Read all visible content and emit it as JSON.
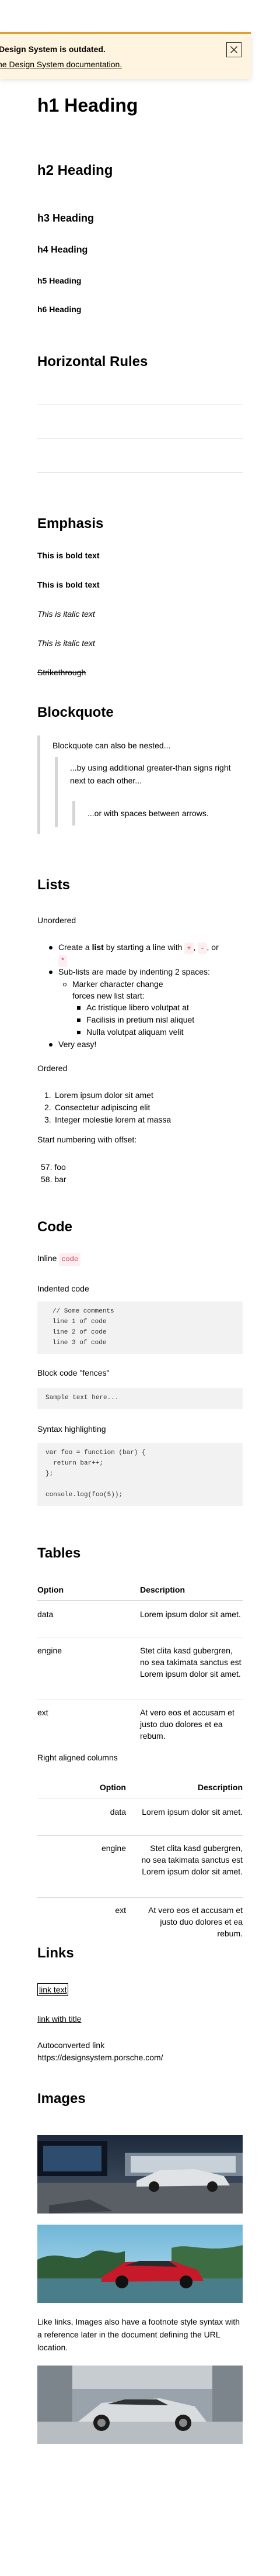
{
  "banner": {
    "title": "Design System is outdated.",
    "link": "he Design System documentation.",
    "close_icon": "close-icon",
    "colors": {
      "background": "#fff4df",
      "accent": "#e0a030"
    }
  },
  "headings": {
    "h1": "h1 Heading",
    "h2": "h2 Heading",
    "h3": "h3 Heading",
    "h4": "h4 Heading",
    "h5": "h5 Heading",
    "h6": "h6 Heading"
  },
  "sections": {
    "horizontal_rules": "Horizontal Rules",
    "emphasis": "Emphasis",
    "blockquote": "Blockquote",
    "lists": "Lists",
    "code": "Code",
    "tables": "Tables",
    "links": "Links",
    "images": "Images"
  },
  "emphasis": {
    "bold1": "This is bold text",
    "bold2": "This is bold text",
    "italic1": "This is italic text",
    "italic2": "This is italic text",
    "strike": "Strikethrough"
  },
  "blockquote": {
    "q1": "Blockquote can also be nested...",
    "q2": "...by using additional greater-than signs right next to each other...",
    "q3": "...or with spaces between arrows."
  },
  "lists": {
    "unordered_label": "Unordered",
    "u1_pre": "Create a ",
    "u1_bold": "list",
    "u1_mid": " by starting a line with ",
    "u1_code1": "+",
    "u1_code2": "-",
    "u1_or": ", or",
    "u1_code3": "*",
    "u2": "Sub-lists are made by indenting 2 spaces:",
    "u2a": "Marker character change forces new list start:",
    "u2a1": "Ac tristique libero volutpat at",
    "u2a2": "Facilisis in pretium nisl aliquet",
    "u2a3": "Nulla volutpat aliquam velit",
    "u3": "Very easy!",
    "ordered_label": "Ordered",
    "o1": "Lorem ipsum dolor sit amet",
    "o2": "Consectetur adipiscing elit",
    "o3": "Integer molestie lorem at massa",
    "offset_label": "Start numbering with offset:",
    "n57": "57. foo",
    "n58": "58. bar",
    "n1": "1.",
    "n2": "2.",
    "n3": "3."
  },
  "code": {
    "inline_label": "Inline",
    "inline_code": "code",
    "indented_label": "Indented code",
    "indented": "// Some comments\nline 1 of code\nline 2 of code\nline 3 of code",
    "fenced_label": "Block code \"fences\"",
    "fenced": "Sample text here...",
    "syntax_label": "Syntax highlighting",
    "syntax": "var foo = function (bar) {\n  return bar++;\n};\n\nconsole.log(foo(5));"
  },
  "tables": {
    "col_option": "Option",
    "col_description": "Description",
    "rows": [
      {
        "option": "data",
        "description": "Lorem ipsum dolor sit amet."
      },
      {
        "option": "engine",
        "description": "Stet clita kasd gubergren, no sea takimata sanctus est Lorem ipsum dolor sit amet."
      },
      {
        "option": "ext",
        "description": "At vero eos et accusam et justo duo dolores et ea rebum."
      }
    ],
    "right_label": "Right aligned columns"
  },
  "links": {
    "text": "link text",
    "with_title": "link with title",
    "auto_label": "Autoconverted link",
    "auto_url": "https://designsystem.porsche.com/"
  },
  "images": {
    "caption": "Like links, Images also have a footnote style syntax with a reference later in the document defining the URL location."
  }
}
